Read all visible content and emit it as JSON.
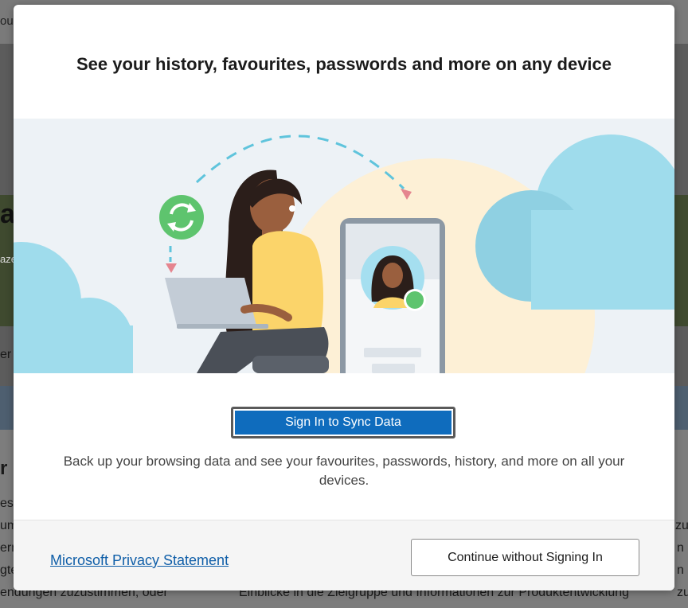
{
  "background_page": {
    "top_fragment": "ou",
    "left_fragments": [
      "a",
      "aze",
      "er",
      "r l",
      "es,",
      "um",
      "erm",
      "gte",
      "endungen zuzustimmen, oder"
    ],
    "right_fragments": [
      "zu",
      "n",
      "n",
      "n",
      "zu"
    ],
    "bottom_text": "Einblicke in die Zielgruppe und Informationen zur Produktentwicklung"
  },
  "dialog": {
    "title": "See your history, favourites, passwords and more on any device",
    "illustration": {
      "name": "sync-illustration",
      "colors": {
        "background": "#edf2f6",
        "cloud": "#9fdcec",
        "sun": "#fdf0d6",
        "sync_icon": "#5ec46e",
        "arrow": "#5fc4dc",
        "arrow_head": "#e5858f",
        "sweater": "#fbd46a",
        "hair": "#2b1e1a",
        "skin": "#9a5f3e",
        "laptop": "#c3ccd6",
        "phone_frame": "#8c98a4"
      }
    },
    "sign_in_button": "Sign In to Sync Data",
    "description": "Back up your browsing data and see your favourites, passwords, history, and more on all your devices.",
    "privacy_link": "Microsoft Privacy Statement",
    "continue_button": "Continue without Signing In"
  },
  "colors": {
    "primary": "#0f6cbd",
    "link": "#0f5ea8"
  }
}
